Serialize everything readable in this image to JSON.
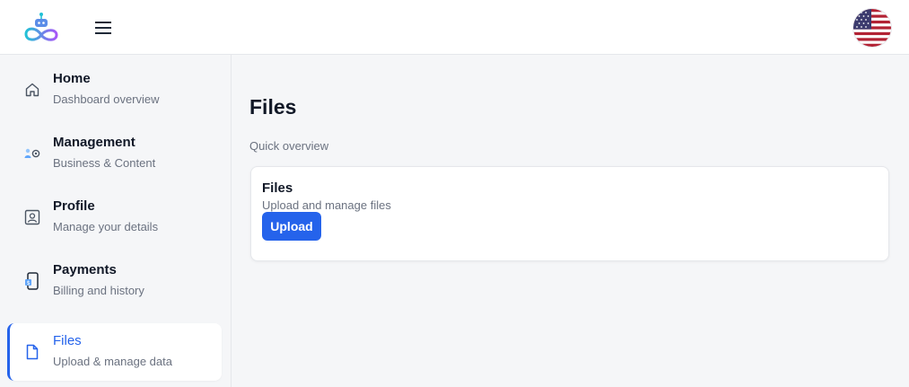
{
  "header": {
    "logo_icon": "robot-infinity-logo",
    "menu_icon": "hamburger-menu-icon",
    "language_icon": "us-flag-icon",
    "colors": {
      "logo_gradient_start": "#22c1d6",
      "logo_gradient_end": "#a855f7"
    }
  },
  "sidebar": {
    "items": [
      {
        "title": "Home",
        "subtitle": "Dashboard overview",
        "icon": "home-icon",
        "active": false
      },
      {
        "title": "Management",
        "subtitle": "Business & Content",
        "icon": "management-icon",
        "active": false
      },
      {
        "title": "Profile",
        "subtitle": "Manage your details",
        "icon": "profile-card-icon",
        "active": false
      },
      {
        "title": "Payments",
        "subtitle": "Billing and history",
        "icon": "payment-phone-icon",
        "active": false
      },
      {
        "title": "Files",
        "subtitle": "Upload & manage data",
        "icon": "file-icon",
        "active": true
      }
    ]
  },
  "main": {
    "title": "Files",
    "section_label": "Quick overview",
    "card": {
      "title": "Files",
      "description": "Upload and manage files",
      "button_label": "Upload"
    }
  },
  "colors": {
    "accent": "#2563eb",
    "background": "#f5f6f8",
    "card": "#ffffff",
    "muted_text": "#6b7280"
  }
}
